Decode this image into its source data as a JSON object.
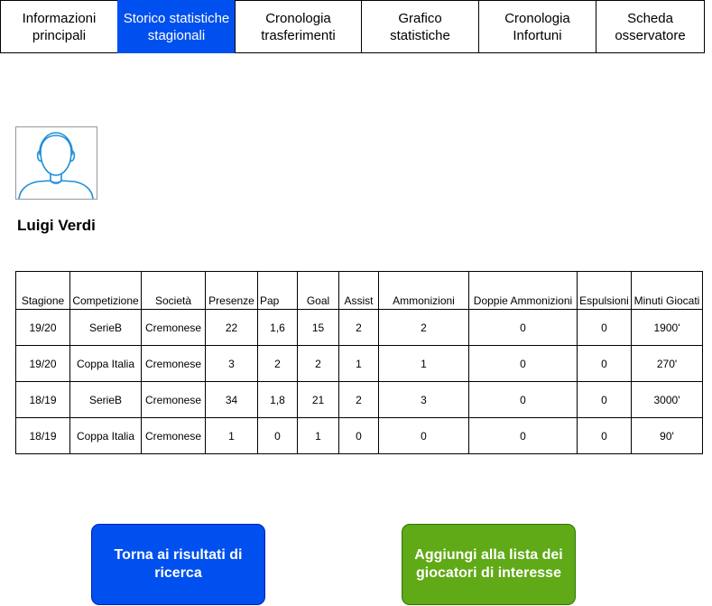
{
  "tabs": [
    {
      "label": "Informazioni\nprincipali"
    },
    {
      "label": "Storico statistiche\nstagionali"
    },
    {
      "label": "Cronologia\ntrasferimenti"
    },
    {
      "label": "Grafico\nstatistiche"
    },
    {
      "label": "Cronologia\nInfortuni"
    },
    {
      "label": "Scheda\nosservatore"
    }
  ],
  "active_tab": "Storico statistiche stagionali",
  "player": {
    "avatar_icon": "user-avatar-icon",
    "name": "Luigi Verdi"
  },
  "stats_table": {
    "headers": [
      "Stagione",
      "Competizione",
      "Società",
      "Presenze",
      "Pap",
      "Goal",
      "Assist",
      "Ammonizioni",
      "Doppie Ammonizioni",
      "Espulsioni",
      "Minuti Giocati"
    ],
    "rows": [
      [
        "19/20",
        "SerieB",
        "Cremonese",
        "22",
        "1,6",
        "15",
        "2",
        "2",
        "0",
        "0",
        "1900'"
      ],
      [
        "19/20",
        "Coppa Italia",
        "Cremonese",
        "3",
        "2",
        "2",
        "1",
        "1",
        "0",
        "0",
        "270'"
      ],
      [
        "18/19",
        "SerieB",
        "Cremonese",
        "34",
        "1,8",
        "21",
        "2",
        "3",
        "0",
        "0",
        "3000'"
      ],
      [
        "18/19",
        "Coppa Italia",
        "Cremonese",
        "1",
        "0",
        "1",
        "0",
        "0",
        "0",
        "0",
        "90'"
      ]
    ]
  },
  "buttons": {
    "back_label": "Torna ai risultati di\nricerca",
    "add_label": "Aggiungi alla lista dei\ngiocatori di interesse"
  },
  "colors": {
    "active_tab": "#0050ef",
    "back_button": "#0050ef",
    "add_button": "#60a917",
    "avatar_stroke": "#1e8fd8"
  }
}
